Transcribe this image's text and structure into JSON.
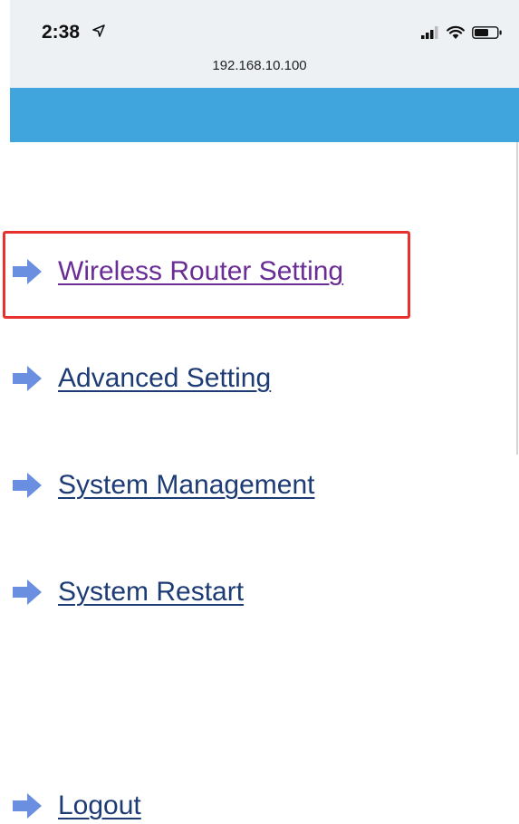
{
  "status_bar": {
    "time": "2:38",
    "url": "192.168.10.100",
    "icons": [
      "location-arrow-icon",
      "signal-icon",
      "wifi-icon",
      "battery-icon"
    ]
  },
  "header": {
    "color": "#3fa5dc"
  },
  "menu": {
    "items": [
      {
        "label": "Wireless Router Setting",
        "state": "visited"
      },
      {
        "label": "Advanced Setting"
      },
      {
        "label": "System Management"
      },
      {
        "label": "System Restart"
      },
      {
        "label": "Logout"
      }
    ]
  },
  "colors": {
    "link": "#1d3b74",
    "link_visited": "#6a2d96",
    "arrow": "#6b8fe0",
    "highlight": "#e8312d"
  }
}
